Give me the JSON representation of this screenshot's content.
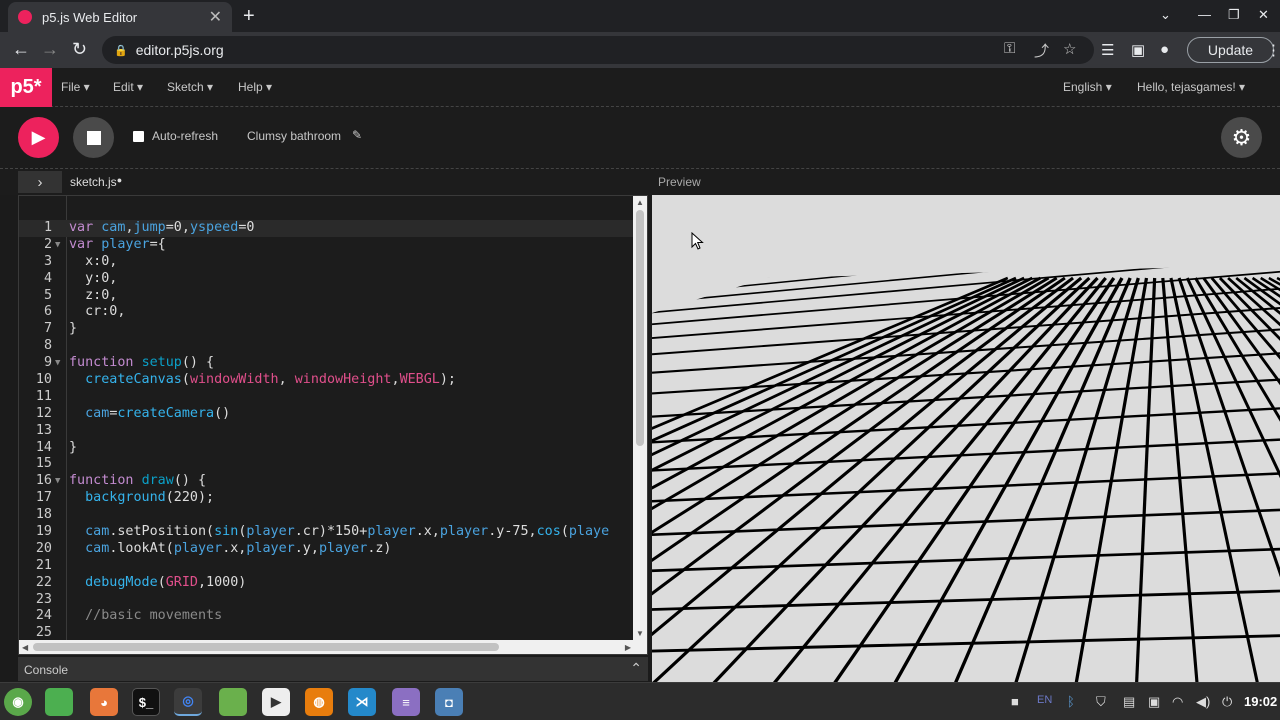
{
  "browser": {
    "tab_title": "p5.js Web Editor",
    "tab_close": "✕",
    "new_tab": "+",
    "url": "editor.p5js.org",
    "update_label": "Update"
  },
  "p5nav": {
    "logo": "p5*",
    "menus": [
      "File ▾",
      "Edit ▾",
      "Sketch ▾",
      "Help ▾"
    ],
    "language": "English ▾",
    "user": "Hello, tejasgames! ▾"
  },
  "toolbar": {
    "auto_refresh_label": "Auto-refresh",
    "sketch_name": "Clumsy bathroom"
  },
  "editor": {
    "file_tab": "sketch.js",
    "preview_label": "Preview",
    "console_label": "Console",
    "active_line": 1,
    "lines": [
      {
        "n": "1",
        "fold": ""
      },
      {
        "n": "2",
        "fold": "▼"
      },
      {
        "n": "3",
        "fold": ""
      },
      {
        "n": "4",
        "fold": ""
      },
      {
        "n": "5",
        "fold": ""
      },
      {
        "n": "6",
        "fold": ""
      },
      {
        "n": "7",
        "fold": ""
      },
      {
        "n": "8",
        "fold": ""
      },
      {
        "n": "9",
        "fold": "▼"
      },
      {
        "n": "10",
        "fold": ""
      },
      {
        "n": "11",
        "fold": ""
      },
      {
        "n": "12",
        "fold": ""
      },
      {
        "n": "13",
        "fold": ""
      },
      {
        "n": "14",
        "fold": ""
      },
      {
        "n": "15",
        "fold": ""
      },
      {
        "n": "16",
        "fold": "▼"
      },
      {
        "n": "17",
        "fold": ""
      },
      {
        "n": "18",
        "fold": ""
      },
      {
        "n": "19",
        "fold": ""
      },
      {
        "n": "20",
        "fold": ""
      },
      {
        "n": "21",
        "fold": ""
      },
      {
        "n": "22",
        "fold": ""
      },
      {
        "n": "23",
        "fold": ""
      },
      {
        "n": "24",
        "fold": ""
      },
      {
        "n": "25",
        "fold": ""
      }
    ],
    "code": [
      [
        [
          "kw",
          "var "
        ],
        [
          "vr",
          "cam"
        ],
        [
          "ob",
          ","
        ],
        [
          "vr",
          "jump"
        ],
        [
          "ob",
          "=0,"
        ],
        [
          "vr",
          "yspeed"
        ],
        [
          "ob",
          "=0"
        ]
      ],
      [
        [
          "kw",
          "var "
        ],
        [
          "vr",
          "player"
        ],
        [
          "ob",
          "={"
        ]
      ],
      [
        [
          "ob",
          "  x:0,"
        ]
      ],
      [
        [
          "ob",
          "  y:0,"
        ]
      ],
      [
        [
          "ob",
          "  z:0,"
        ]
      ],
      [
        [
          "ob",
          "  cr:0,"
        ]
      ],
      [
        [
          "ob",
          "}"
        ]
      ],
      [],
      [
        [
          "kw",
          "function "
        ],
        [
          "fn",
          "setup"
        ],
        [
          "ob",
          "() {"
        ]
      ],
      [
        [
          "ob",
          "  "
        ],
        [
          "bi",
          "createCanvas"
        ],
        [
          "ob",
          "("
        ],
        [
          "cs",
          "windowWidth"
        ],
        [
          "ob",
          ", "
        ],
        [
          "cs",
          "windowHeight"
        ],
        [
          "ob",
          ","
        ],
        [
          "cs",
          "WEBGL"
        ],
        [
          "ob",
          ");"
        ]
      ],
      [],
      [
        [
          "ob",
          "  "
        ],
        [
          "vr",
          "cam"
        ],
        [
          "ob",
          "="
        ],
        [
          "bi",
          "createCamera"
        ],
        [
          "ob",
          "()"
        ]
      ],
      [],
      [
        [
          "ob",
          "}"
        ]
      ],
      [],
      [
        [
          "kw",
          "function "
        ],
        [
          "fn",
          "draw"
        ],
        [
          "ob",
          "() {"
        ]
      ],
      [
        [
          "ob",
          "  "
        ],
        [
          "bi",
          "background"
        ],
        [
          "ob",
          "(220);"
        ]
      ],
      [],
      [
        [
          "ob",
          "  "
        ],
        [
          "vr",
          "cam"
        ],
        [
          "ob",
          ".setPosition("
        ],
        [
          "bi",
          "sin"
        ],
        [
          "ob",
          "("
        ],
        [
          "vr",
          "player"
        ],
        [
          "ob",
          ".cr)*150+"
        ],
        [
          "vr",
          "player"
        ],
        [
          "ob",
          ".x,"
        ],
        [
          "vr",
          "player"
        ],
        [
          "ob",
          ".y-75,"
        ],
        [
          "bi",
          "cos"
        ],
        [
          "ob",
          "("
        ],
        [
          "vr",
          "playe"
        ]
      ],
      [
        [
          "ob",
          "  "
        ],
        [
          "vr",
          "cam"
        ],
        [
          "ob",
          ".lookAt("
        ],
        [
          "vr",
          "player"
        ],
        [
          "ob",
          ".x,"
        ],
        [
          "vr",
          "player"
        ],
        [
          "ob",
          ".y,"
        ],
        [
          "vr",
          "player"
        ],
        [
          "ob",
          ".z)"
        ]
      ],
      [],
      [
        [
          "ob",
          "  "
        ],
        [
          "bi",
          "debugMode"
        ],
        [
          "ob",
          "("
        ],
        [
          "cs",
          "GRID"
        ],
        [
          "ob",
          ",1000)"
        ]
      ],
      [],
      [
        [
          "cm",
          "  //basic movements"
        ]
      ],
      []
    ]
  },
  "taskbar": {
    "tray_lang": "EN",
    "clock": "19:02"
  },
  "colors": {
    "accent": "#ed225d",
    "preview_bg": "#dcdcdc"
  }
}
